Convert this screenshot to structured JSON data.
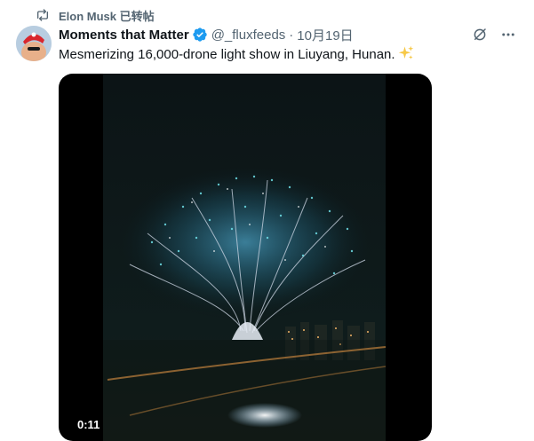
{
  "repost": {
    "label": "Elon Musk 已转帖"
  },
  "author": {
    "name": "Moments that Matter",
    "handle": "@_fluxfeeds",
    "separator": "·",
    "timestamp": "10月19日"
  },
  "tweet": {
    "text": "Mesmerizing 16,000-drone light show in Liuyang, Hunan."
  },
  "video": {
    "duration": "0:11"
  },
  "colors": {
    "verified": "#1d9bf0",
    "secondary_text": "#536471",
    "primary_text": "#0f1419",
    "sparkle": "#f7c948"
  },
  "icons": {
    "repost": "repost-icon",
    "verified": "verified-badge-icon",
    "grok": "grok-icon",
    "more": "more-icon",
    "sparkle": "sparkles-icon"
  }
}
